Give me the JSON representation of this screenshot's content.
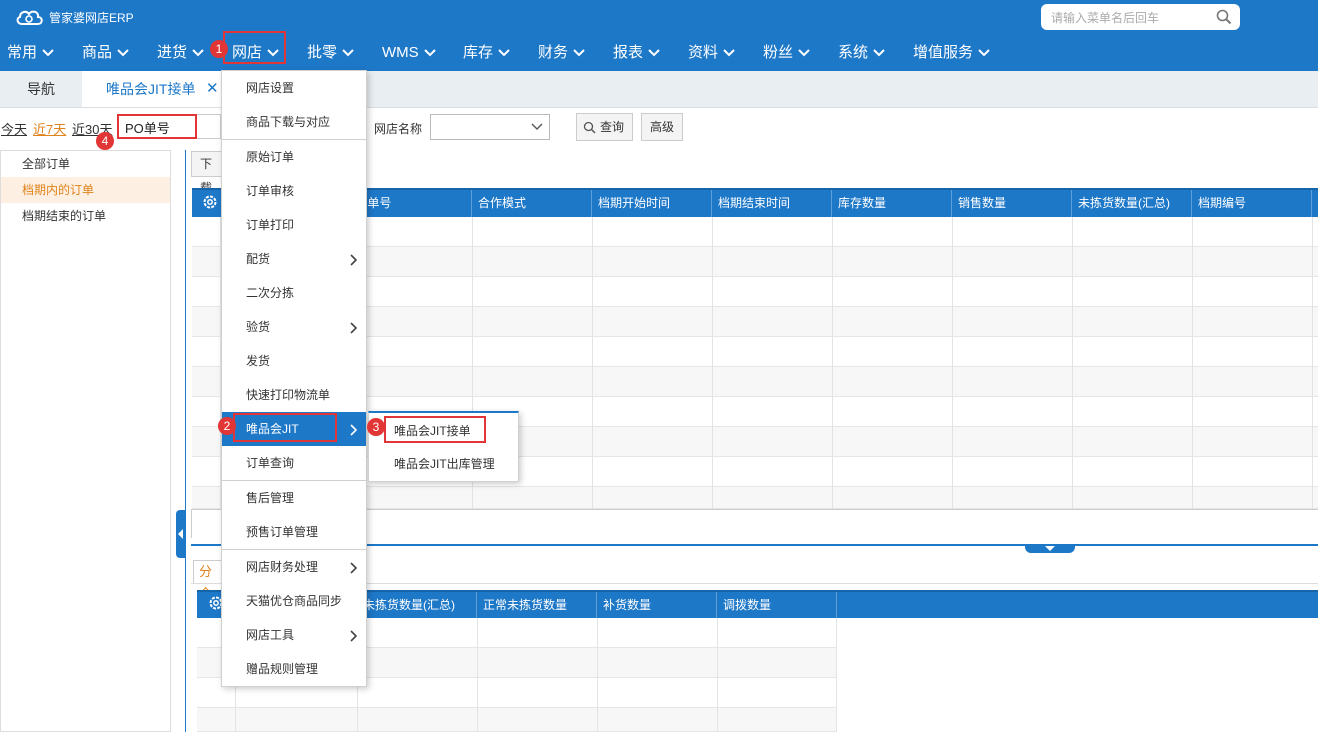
{
  "app": {
    "logo_text": "管家婆网店ERP",
    "search_placeholder": "请输入菜单名后回车"
  },
  "nav": [
    "常用",
    "商品",
    "进货",
    "网店",
    "批零",
    "WMS",
    "库存",
    "财务",
    "报表",
    "资料",
    "粉丝",
    "系统",
    "增值服务"
  ],
  "tabs": {
    "nav_label": "导航",
    "active_label": "唯品会JIT接单",
    "close_glyph": "✕"
  },
  "filters": {
    "today": "今天",
    "last7": "近7天",
    "last30": "近30天",
    "po_value": "PO单号",
    "shop_label": "网店名称",
    "query_btn": "查询",
    "advanced_btn": "高级"
  },
  "sidebar": [
    "全部订单",
    "档期内的订单",
    "档期结束的订单"
  ],
  "toolbar": {
    "partial_btn": "下载",
    "tab2": "分合"
  },
  "grid": {
    "headers": [
      "O单号",
      "合作模式",
      "档期开始时间",
      "档期结束时间",
      "库存数量",
      "销售数量",
      "未拣货数量(汇总)",
      "档期编号"
    ]
  },
  "grid2": {
    "headers": [
      "未拣货数量(汇总)",
      "正常未拣货数量",
      "补货数量",
      "调拨数量"
    ]
  },
  "menu": [
    "网店设置",
    "商品下载与对应",
    "原始订单",
    "订单审核",
    "订单打印",
    "配货",
    "二次分拣",
    "验货",
    "发货",
    "快速打印物流单",
    "唯品会JIT",
    "订单查询",
    "售后管理",
    "预售订单管理",
    "网店财务处理",
    "天猫优仓商品同步",
    "网店工具",
    "赠品规则管理"
  ],
  "submenu": [
    "唯品会JIT接单",
    "唯品会JIT出库管理"
  ],
  "badges": [
    "1",
    "2",
    "3",
    "4"
  ],
  "colors": {
    "primary": "#1e78c8",
    "highlight": "#e23535",
    "accent": "#e0821c"
  }
}
